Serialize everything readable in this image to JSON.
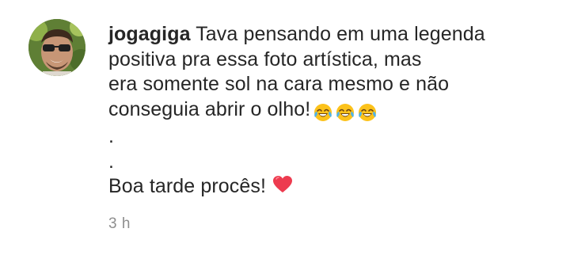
{
  "comment": {
    "username": "jogagiga",
    "lines": [
      "Tava pensando em uma legenda",
      "positiva pra essa foto artística, mas",
      "era somente sol na cara mesmo e não",
      "conseguia abrir o olho!",
      ".",
      ".",
      "Boa tarde procês!"
    ],
    "emojis": [
      "face-with-tears-of-joy-icon",
      "face-with-tears-of-joy-icon",
      "face-with-tears-of-joy-icon"
    ],
    "end_emoji": "red-heart-icon",
    "timestamp": "3 h"
  },
  "colors": {
    "text": "#262626",
    "muted": "#8e8e8e",
    "heart": "#ed3b4f",
    "emoji_face": "#fcc21b"
  }
}
